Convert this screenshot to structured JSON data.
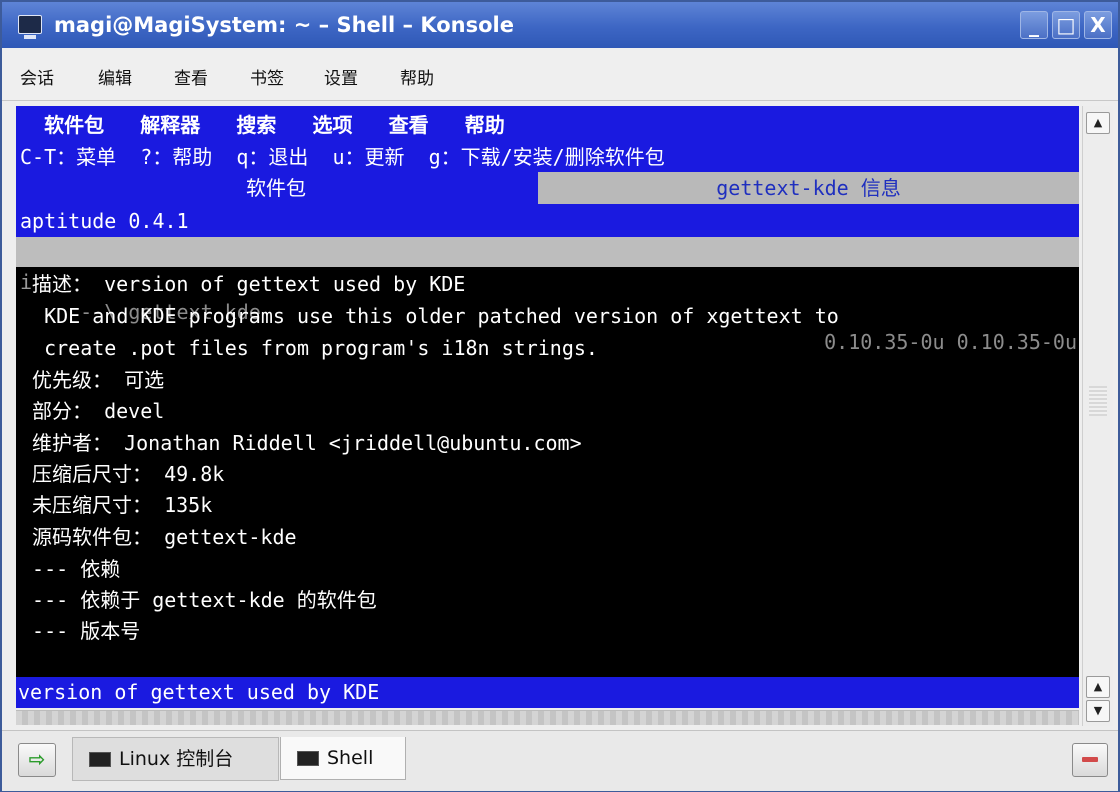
{
  "window": {
    "title": "magi@MagiSystem: ~ – Shell – Konsole",
    "buttons": {
      "minimize": "_",
      "maximize": "□",
      "close": "X"
    }
  },
  "menubar": {
    "items": [
      "会话",
      "编辑",
      "查看",
      "书签",
      "设置",
      "帮助"
    ]
  },
  "terminal": {
    "menu": "  软件包   解释器   搜索   选项   查看   帮助",
    "keys": "C-T：菜单  ?：帮助  q：退出  u：更新  g：下载/安装/删除软件包",
    "pkg_header": "软件包",
    "info_header": "gettext-kde 信息",
    "version_line": "aptitude 0.4.1",
    "selected": {
      "marker": "i",
      "name": "    --\\ gettext-kde",
      "versions": "0.10.35-0u 0.10.35-0u"
    },
    "lines": [
      " 描述： version of gettext used by KDE",
      "  KDE and KDE programs use this older patched version of xgettext to",
      "  create .pot files from program's i18n strings.",
      " 优先级： 可选",
      " 部分： devel",
      " 维护者： Jonathan Riddell <jriddell@ubuntu.com>",
      " 压缩后尺寸： 49.8k",
      " 未压缩尺寸： 135k",
      " 源码软件包： gettext-kde",
      " --- 依赖",
      " --- 依赖于 gettext-kde 的软件包",
      " --- 版本号"
    ],
    "status": "version of gettext used by KDE"
  },
  "tabs": [
    {
      "label": "Linux 控制台",
      "active": false
    },
    {
      "label": "Shell",
      "active": true
    }
  ],
  "colors": {
    "titlebar": "#3d66c4",
    "terminal_bg": "#000000",
    "terminal_bar": "#1a1ae0",
    "info_header_text": "#1f2fbf"
  }
}
